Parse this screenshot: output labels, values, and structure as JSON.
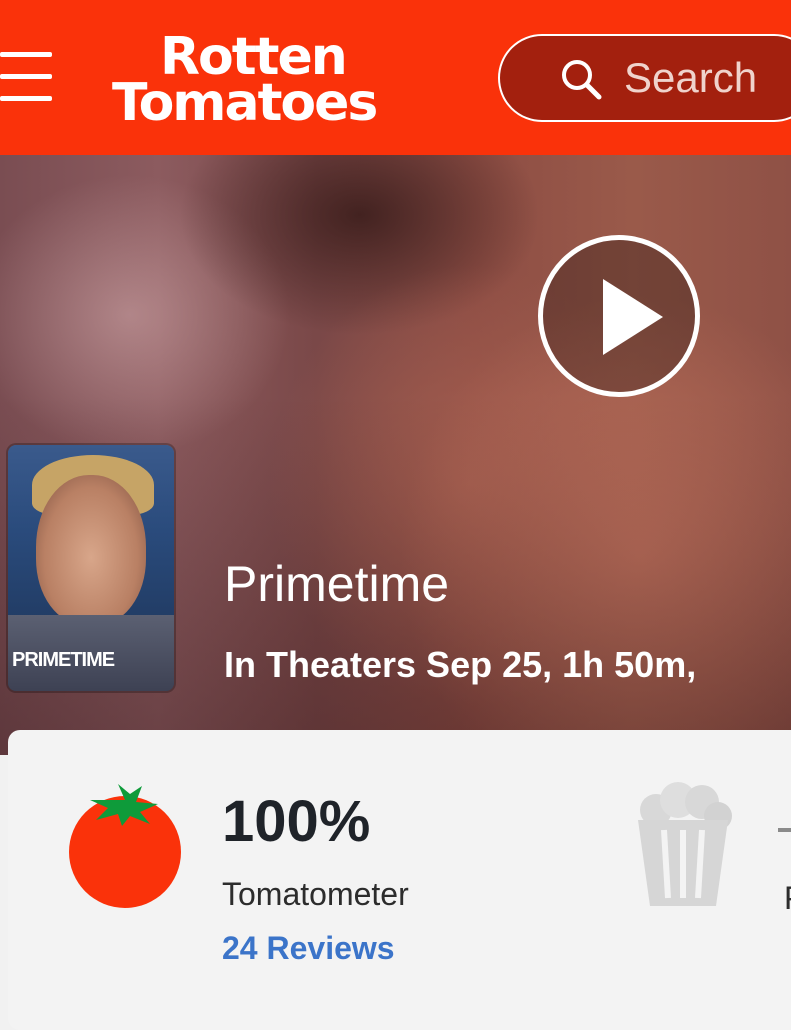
{
  "header": {
    "brand_line1": "Rotten",
    "brand_line2": "Tomatoes",
    "search_placeholder": "Search",
    "brand_color": "#fa320a"
  },
  "hero": {
    "title": "Primetime",
    "meta": "In Theaters Sep 25, 1h 50m, ",
    "poster_title": "PRIMETIME"
  },
  "scores": {
    "tomatometer_value": "100%",
    "tomatometer_label": "Tomatometer",
    "reviews_link": "24 Reviews",
    "audience_label": "P"
  },
  "icons": [
    "menu-icon",
    "search-icon",
    "play-icon",
    "tomato-icon",
    "popcorn-icon"
  ]
}
